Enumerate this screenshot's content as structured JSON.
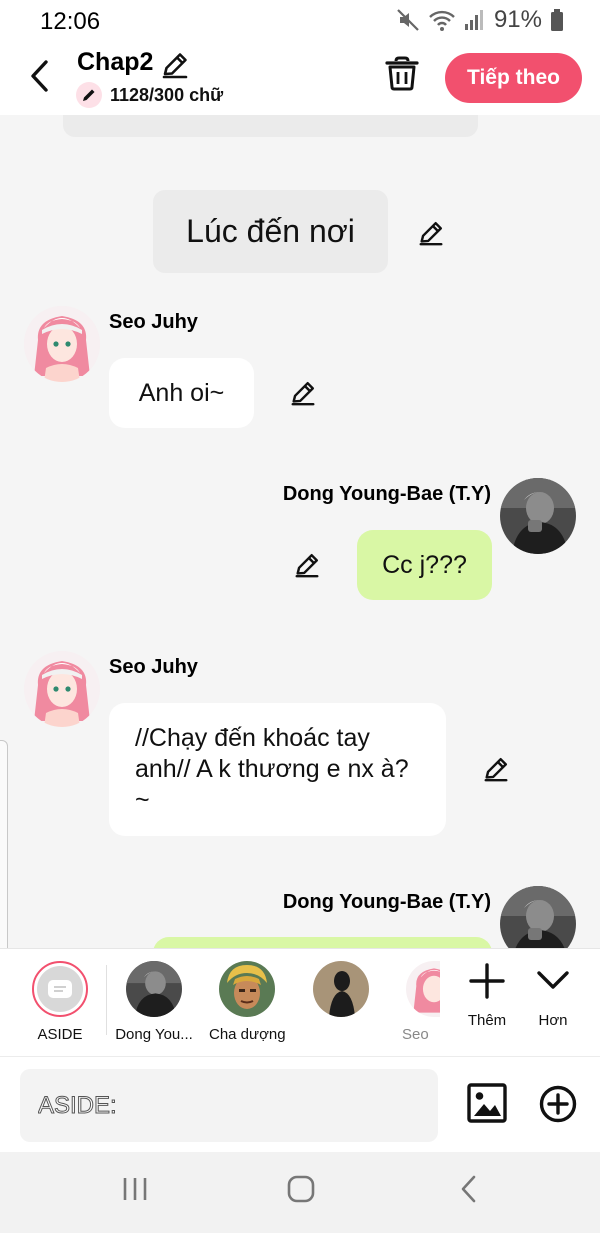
{
  "status_bar": {
    "time": "12:06",
    "battery": "91%",
    "icons": [
      "mute-icon",
      "wifi-icon",
      "signal-icon",
      "battery-icon"
    ]
  },
  "header": {
    "title": "Chap2",
    "word_count": "1128/300 chữ",
    "next_label": "Tiếp theo",
    "accent": "#f2506e"
  },
  "chat": {
    "narration": "Lúc đến nơi",
    "messages": [
      {
        "sender": "Seo Juhy",
        "side": "left",
        "text": "Anh oi~"
      },
      {
        "sender": "Dong Young-Bae (T.Y)",
        "side": "right",
        "text": "Cc j???"
      },
      {
        "sender": "Seo Juhy",
        "side": "left",
        "text": "//Chạy đến khoác tay anh// A k thương e nx à?~"
      },
      {
        "sender": "Dong Young-Bae (T.Y)",
        "side": "right",
        "text": ""
      }
    ],
    "bubble_colors": {
      "left": "#ffffff",
      "right": "#d9f7a5"
    }
  },
  "characters": {
    "items": [
      {
        "name": "ASIDE"
      },
      {
        "name": "Dong You..."
      },
      {
        "name": "Cha dượng"
      },
      {
        "name": ""
      },
      {
        "name": "Seo"
      }
    ],
    "add_label": "Thêm",
    "more_label": "Hơn"
  },
  "input": {
    "placeholder": "ASIDE:"
  }
}
